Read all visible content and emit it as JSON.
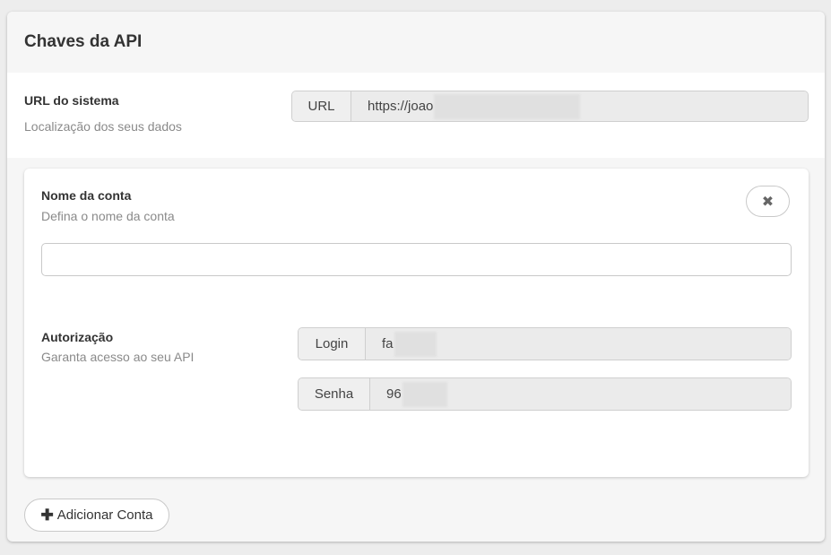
{
  "header": {
    "title": "Chaves da API"
  },
  "system_url": {
    "label": "URL do sistema",
    "description": "Localização dos seus dados",
    "addon": "URL",
    "value": "https://joao"
  },
  "account": {
    "name_label": "Nome da conta",
    "name_description": "Defina o nome da conta",
    "name_value": "",
    "close_icon": "close-icon",
    "close_glyph": "✖",
    "auth_label": "Autorização",
    "auth_description": "Garanta acesso ao seu API",
    "login_addon": "Login",
    "login_value": "fa",
    "password_addon": "Senha",
    "password_value": "96"
  },
  "actions": {
    "add_icon": "plus-icon",
    "add_glyph": "✚",
    "add_label": "Adicionar Conta"
  }
}
